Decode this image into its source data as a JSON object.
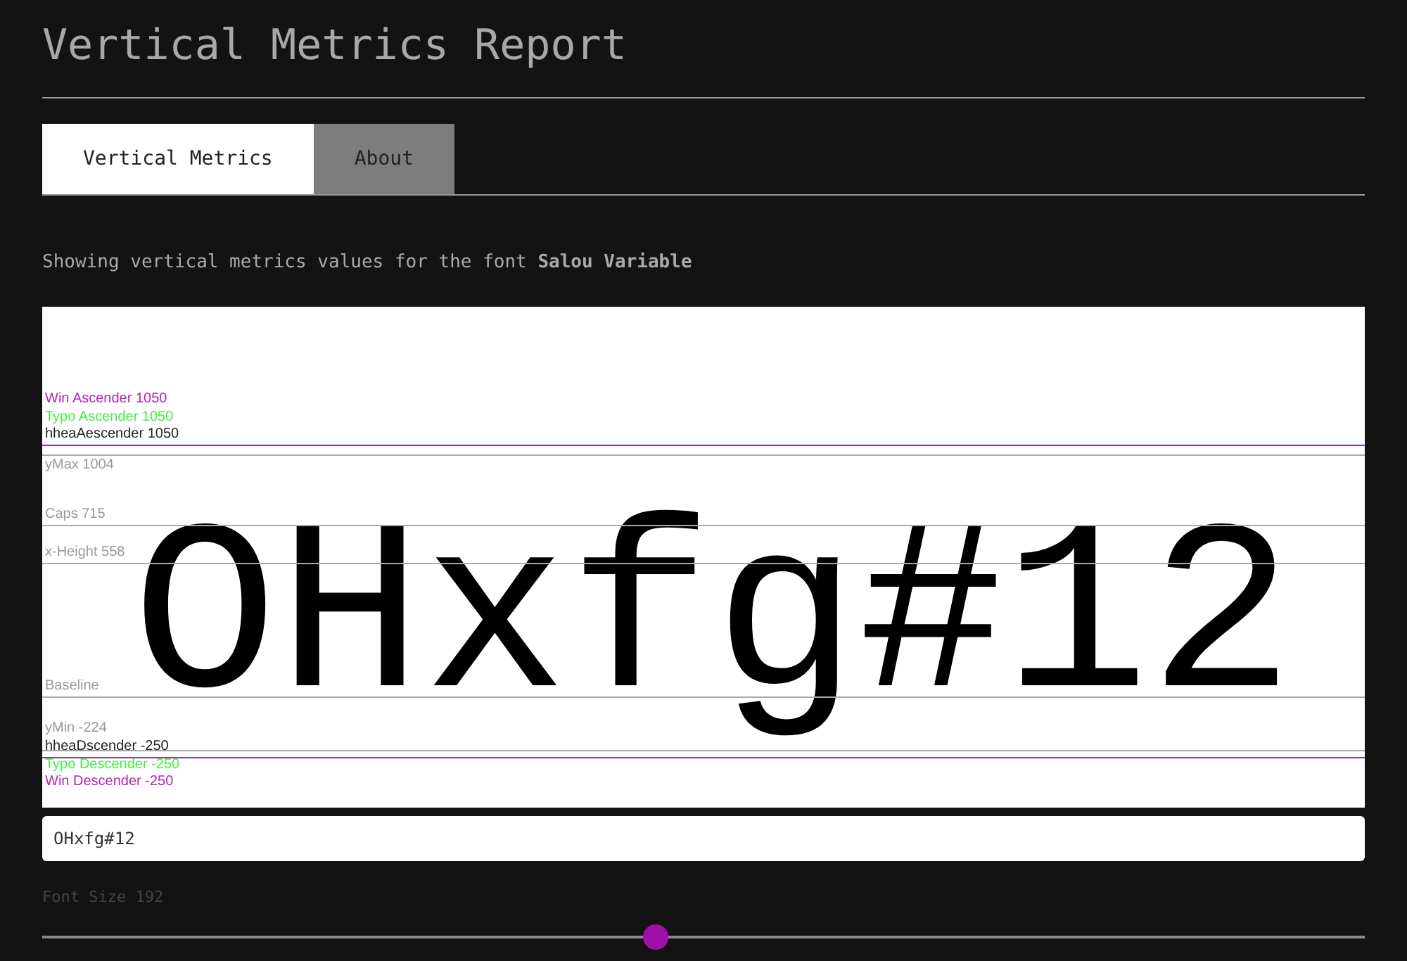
{
  "title": "Vertical Metrics Report",
  "tabs": [
    {
      "label": "Vertical Metrics",
      "selected": true
    },
    {
      "label": "About",
      "selected": false
    }
  ],
  "description": "Showing vertical metrics values for the font **Salou Variable**",
  "metrics": [
    {
      "label": "Win Ascender 1050",
      "color": "#b026b6"
    },
    {
      "label": "Typo Ascender 1050",
      "color": "#44ee44"
    },
    {
      "label": "hheaAescender 1050",
      "color": "#222222"
    },
    {
      "label": "yMax 1004",
      "color": "#999999"
    },
    {
      "label": "Caps 715",
      "color": "#999999"
    },
    {
      "label": "x-Height 558",
      "color": "#999999"
    },
    {
      "label": "Baseline",
      "color": "#999999"
    },
    {
      "label": "yMin -224",
      "color": "#999999"
    },
    {
      "label": "hheaDscender -250",
      "color": "#222222"
    },
    {
      "label": "Typo Descender -250",
      "color": "#44ee44"
    },
    {
      "label": "Win Descender -250",
      "color": "#b026b6"
    }
  ],
  "sample_text": "OHxfg#12",
  "text_input": {
    "value": "OHxfg#12"
  },
  "font_size": {
    "label": "Font Size 192",
    "level": 0.464
  }
}
